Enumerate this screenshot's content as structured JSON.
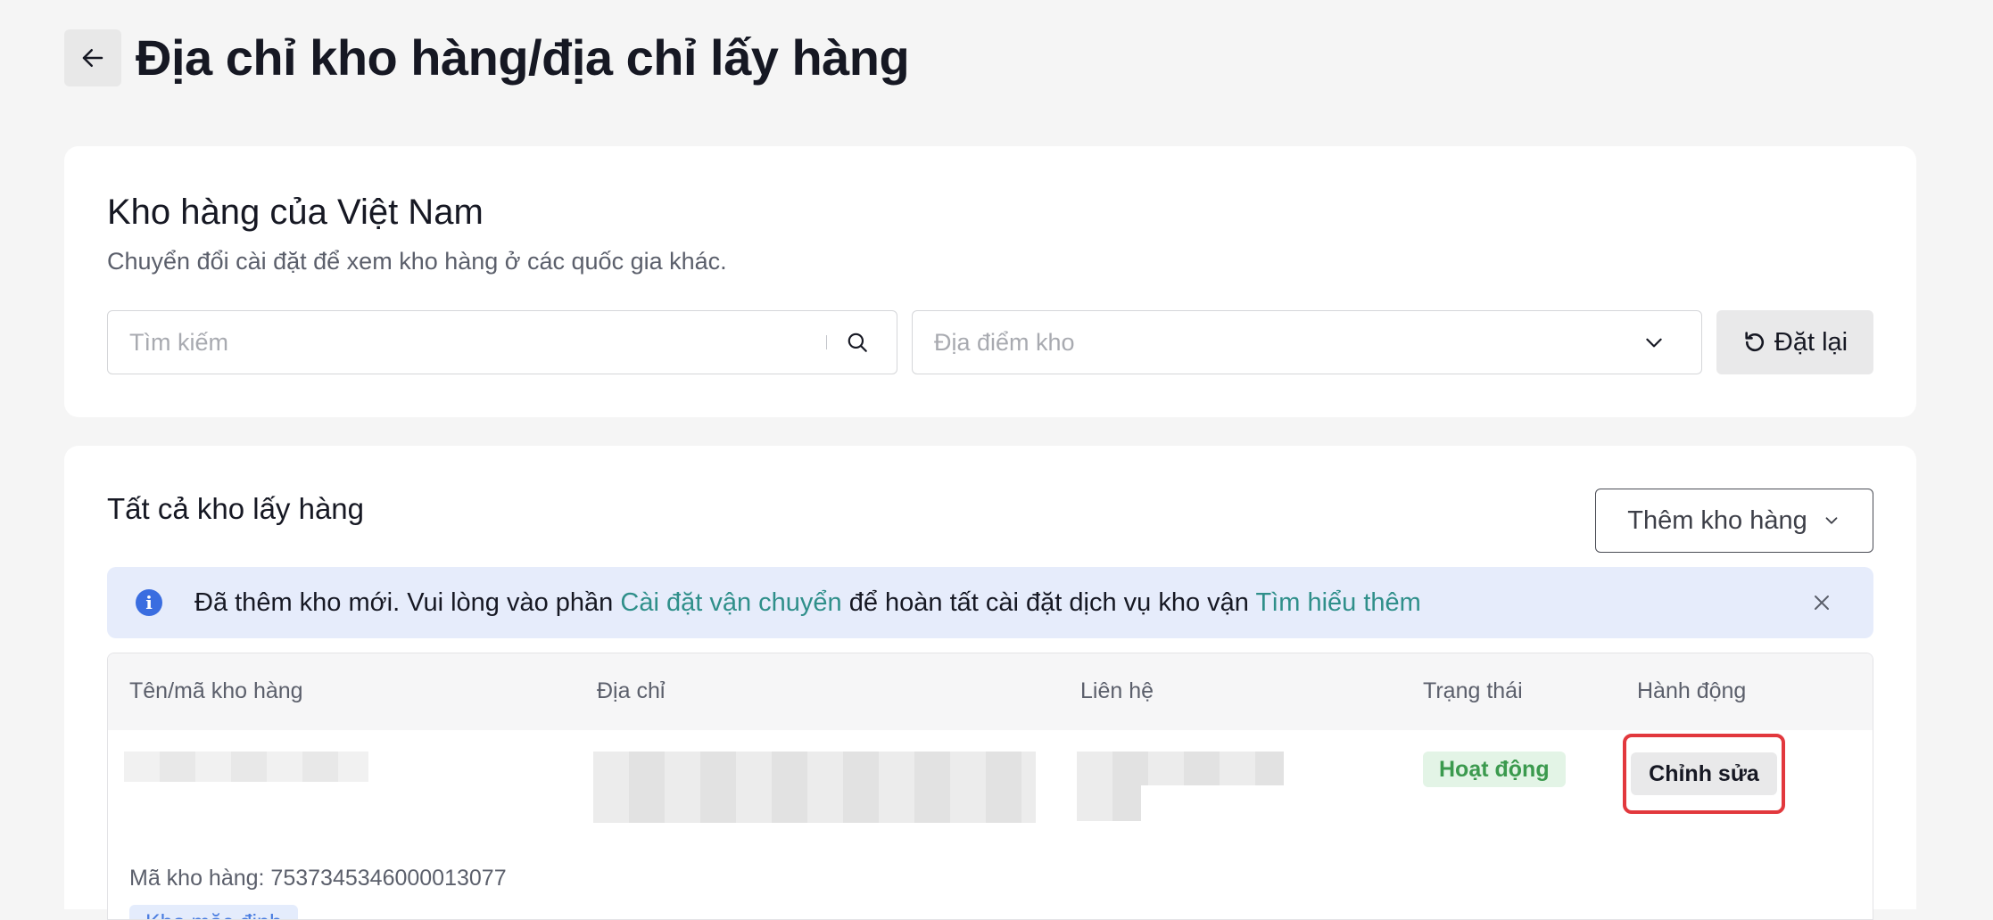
{
  "header": {
    "back_icon": "arrow-left-icon",
    "title": "Địa chỉ kho hàng/địa chỉ lấy hàng"
  },
  "filters": {
    "title": "Kho hàng của Việt Nam",
    "subtitle": "Chuyển đổi cài đặt để xem kho hàng ở các quốc gia khác.",
    "search_placeholder": "Tìm kiếm",
    "location_placeholder": "Địa điểm kho",
    "reset_label": "Đặt lại"
  },
  "warehouses": {
    "title": "Tất cả kho lấy hàng",
    "add_label": "Thêm kho hàng",
    "banner": {
      "text_before": "Đã thêm kho mới. Vui lòng vào phần ",
      "link_settings": "Cài đặt vận chuyển",
      "text_middle": " để hoàn tất cài đặt dịch vụ kho vận ",
      "link_learn": "Tìm hiểu thêm"
    },
    "columns": [
      "Tên/mã kho hàng",
      "Địa chỉ",
      "Liên hệ",
      "Trạng thái",
      "Hành động"
    ],
    "rows": [
      {
        "code": "Mã kho hàng: 7537345346000013077",
        "default_tag": "Kho mặc định",
        "status": "Hoạt động",
        "action": "Chỉnh sửa"
      }
    ]
  },
  "colors": {
    "link": "#2f8f8a",
    "info": "#3a6de0",
    "status_active": "#3b9a4e",
    "highlight": "#e2383d"
  }
}
